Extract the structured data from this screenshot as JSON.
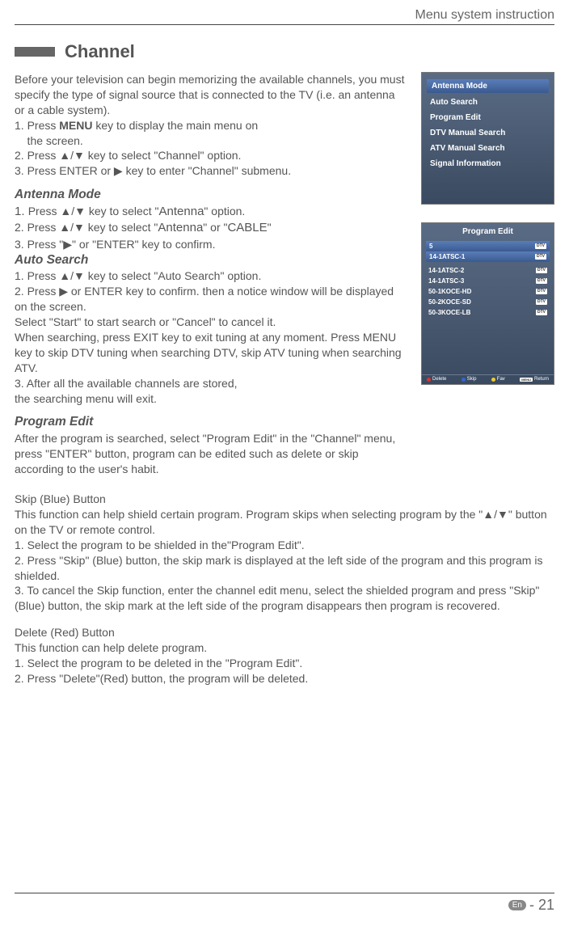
{
  "header": {
    "title": "Menu system instruction"
  },
  "section": {
    "title": "Channel"
  },
  "intro": {
    "p1": "Before your television can begin memorizing the available channels, you must specify the type of signal source that is connected to the TV (i.e. an antenna or a cable system).",
    "l1a": "1. Press ",
    "l1b": "MENU",
    "l1c": " key to display the main menu on",
    "l1d": "    the screen.",
    "l2": "2. Press ▲/▼ key to select \"Channel\" option.",
    "l3": "3. Press ENTER or ▶ key to enter \"Channel\" submenu."
  },
  "antennaMode": {
    "heading": "Antenna Mode",
    "l1a": "1. ",
    "l1b": "Press ▲/▼ key to select \"",
    "l1c": "Antenna",
    "l1d": "\" option.",
    "l2a": "2. Press  ▲/▼ key to select  \"",
    "l2b": "Antenna",
    "l2c": "\"  or \"",
    "l2d": "CABLE",
    "l2e": "\"",
    "l3": "3. Press \"▶\" or \"ENTER\" key to confirm."
  },
  "autoSearch": {
    "heading": "Auto Search",
    "l1": "1. Press ▲/▼ key to select \"Auto Search\" option.",
    "l2": "2. Press ▶ or ENTER key to confirm. then a notice window will be displayed on the screen.",
    "l3": "Select \"Start\" to start search or \"Cancel\" to cancel it.",
    "l4": "When searching, press EXIT key to exit tuning at any moment. Press MENU key to skip DTV tuning when searching DTV, skip ATV tuning when searching ATV.",
    "l5": "3. After all the available channels are stored,",
    "l6": "the searching menu will exit."
  },
  "programEdit": {
    "heading": "Program Edit",
    "p": "After the program is searched, select \"Program Edit\" in the \"Channel\" menu, press \"ENTER\" button, program can be edited such as delete or skip according to the user's habit."
  },
  "skip": {
    "heading": "Skip (Blue) Button",
    "p1": "This function can help shield certain program. Program skips when selecting program by the \"▲/▼\" button on the TV or  remote control.",
    "l1": "1. Select the program to be shielded in the\"Program Edit\".",
    "l2": "2. Press \"Skip\" (Blue) button, the skip mark is displayed at the left side of the program and this program is shielded.",
    "l3": "3. To cancel the Skip function, enter the channel edit menu, select the shielded program and press \"Skip\" (Blue) button, the skip mark at the left side of the program disappears then program is recovered."
  },
  "delete": {
    "heading": "Delete (Red) Button",
    "p1": "This function can help delete program.",
    "l1": "1. Select the program to be deleted in the \"Program Edit\".",
    "l2": "2. Press \"Delete\"(Red) button, the program will be deleted."
  },
  "panel1": {
    "items": [
      {
        "label": "Antenna Mode"
      },
      {
        "label": "Auto Search"
      },
      {
        "label": "Program Edit"
      },
      {
        "label": "DTV Manual Search"
      },
      {
        "label": "ATV Manual Search"
      },
      {
        "label": "Signal Information"
      }
    ]
  },
  "panel2": {
    "title": "Program Edit",
    "rows": [
      {
        "ch": "5",
        "badge": "DTV"
      },
      {
        "ch": "14-1ATSC-1",
        "badge": "DTV"
      },
      {
        "ch": "14-1ATSC-2",
        "badge": "DTV"
      },
      {
        "ch": "14-1ATSC-3",
        "badge": "DTV"
      },
      {
        "ch": "50-1KOCE-HD",
        "badge": "DTV"
      },
      {
        "ch": "50-2KOCE-SD",
        "badge": "DTV"
      },
      {
        "ch": "50-3KOCE-LB",
        "badge": "DTV"
      }
    ],
    "footer": {
      "delete": "Delete",
      "skip": "Skip",
      "fav": "Fav",
      "menu": "MENU",
      "return": "Return"
    }
  },
  "footer": {
    "lang": "En",
    "page": "- 21"
  }
}
